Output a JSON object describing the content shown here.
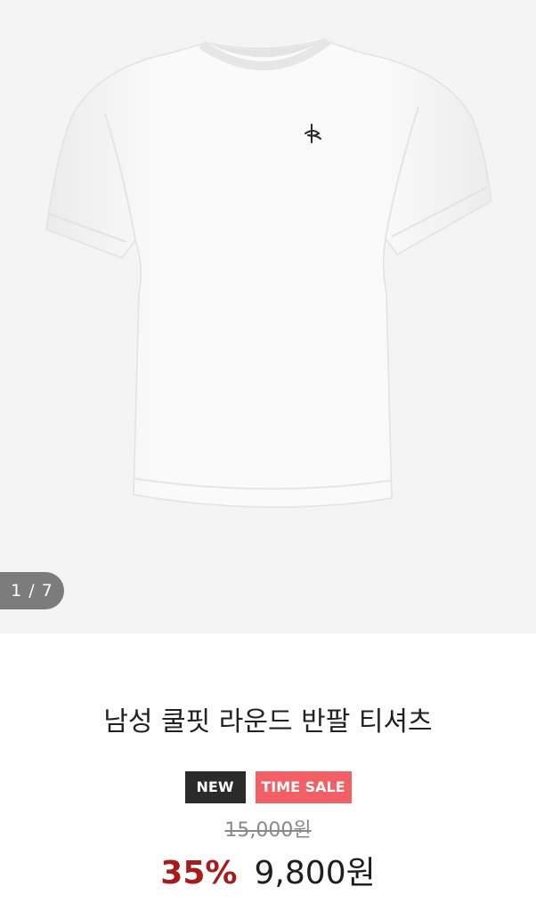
{
  "gallery": {
    "counter": "1 / 7",
    "image_alt": "white t-shirt with small logo"
  },
  "product": {
    "title": "남성 쿨핏 라운드 반팔 티셔츠",
    "badges": {
      "new": "NEW",
      "time_sale": "TIME SALE"
    },
    "original_price": "15,000원",
    "discount": "35%",
    "sale_price": "9,800원"
  },
  "colors": {
    "gallery_bg": "#f4f4f4",
    "badge_new": "#2b2b2b",
    "badge_sale": "#f26065",
    "discount": "#a81b1b"
  }
}
